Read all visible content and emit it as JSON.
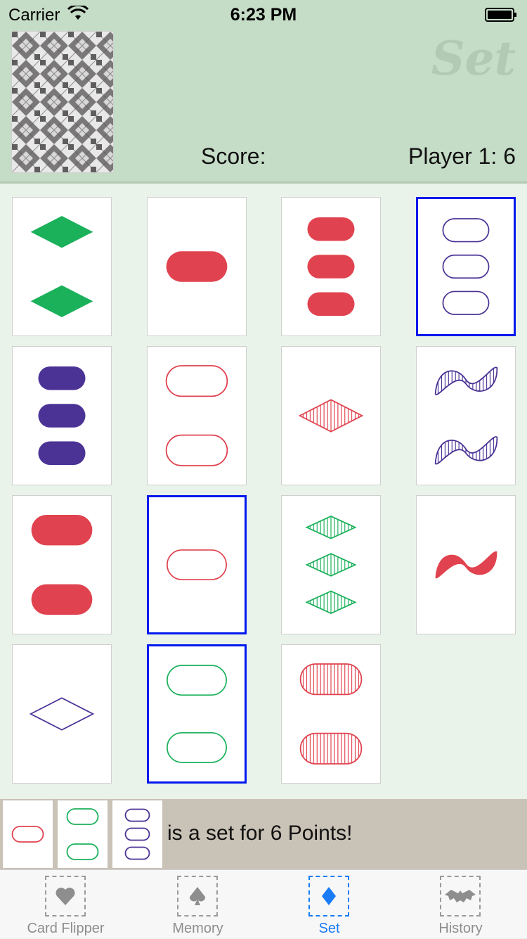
{
  "status_bar": {
    "carrier": "Carrier",
    "time": "6:23 PM"
  },
  "header": {
    "game_title": "Set",
    "score_label": "Score:",
    "score_value": "Player 1: 6"
  },
  "colors": {
    "red": "#e0434f",
    "green": "#1bb15b",
    "purple": "#4b3396",
    "selection": "#0018ee",
    "tab_active": "#1a7bf7"
  },
  "cards": [
    {
      "count": 2,
      "shape": "diamond",
      "shading": "solid",
      "color": "green",
      "selected": false
    },
    {
      "count": 1,
      "shape": "oval",
      "shading": "solid",
      "color": "red",
      "selected": false
    },
    {
      "count": 3,
      "shape": "oval",
      "shading": "solid",
      "color": "red",
      "selected": false
    },
    {
      "count": 3,
      "shape": "oval",
      "shading": "open",
      "color": "purple",
      "selected": true
    },
    {
      "count": 3,
      "shape": "oval",
      "shading": "solid",
      "color": "purple",
      "selected": false
    },
    {
      "count": 2,
      "shape": "oval",
      "shading": "open",
      "color": "red",
      "selected": false
    },
    {
      "count": 1,
      "shape": "diamond",
      "shading": "striped",
      "color": "red",
      "selected": false
    },
    {
      "count": 2,
      "shape": "squiggle",
      "shading": "striped",
      "color": "purple",
      "selected": false
    },
    {
      "count": 2,
      "shape": "oval",
      "shading": "solid",
      "color": "red",
      "selected": false
    },
    {
      "count": 1,
      "shape": "oval",
      "shading": "open",
      "color": "red",
      "selected": true
    },
    {
      "count": 3,
      "shape": "diamond",
      "shading": "striped",
      "color": "green",
      "selected": false
    },
    {
      "count": 1,
      "shape": "squiggle",
      "shading": "solid",
      "color": "red",
      "selected": false
    },
    {
      "count": 1,
      "shape": "diamond",
      "shading": "open",
      "color": "purple",
      "selected": false
    },
    {
      "count": 2,
      "shape": "oval",
      "shading": "open",
      "color": "green",
      "selected": true
    },
    {
      "count": 2,
      "shape": "oval",
      "shading": "striped",
      "color": "red",
      "selected": false
    }
  ],
  "result": {
    "cards": [
      {
        "count": 1,
        "shape": "oval",
        "shading": "open",
        "color": "red"
      },
      {
        "count": 2,
        "shape": "oval",
        "shading": "open",
        "color": "green"
      },
      {
        "count": 3,
        "shape": "oval",
        "shading": "open",
        "color": "purple"
      }
    ],
    "message": "is a set for 6 Points!"
  },
  "tabs": [
    {
      "label": "Card Flipper",
      "icon": "heart-icon",
      "active": false
    },
    {
      "label": "Memory",
      "icon": "spade-icon",
      "active": false
    },
    {
      "label": "Set",
      "icon": "diamond-icon",
      "active": true
    },
    {
      "label": "History",
      "icon": "bat-icon",
      "active": false
    }
  ]
}
